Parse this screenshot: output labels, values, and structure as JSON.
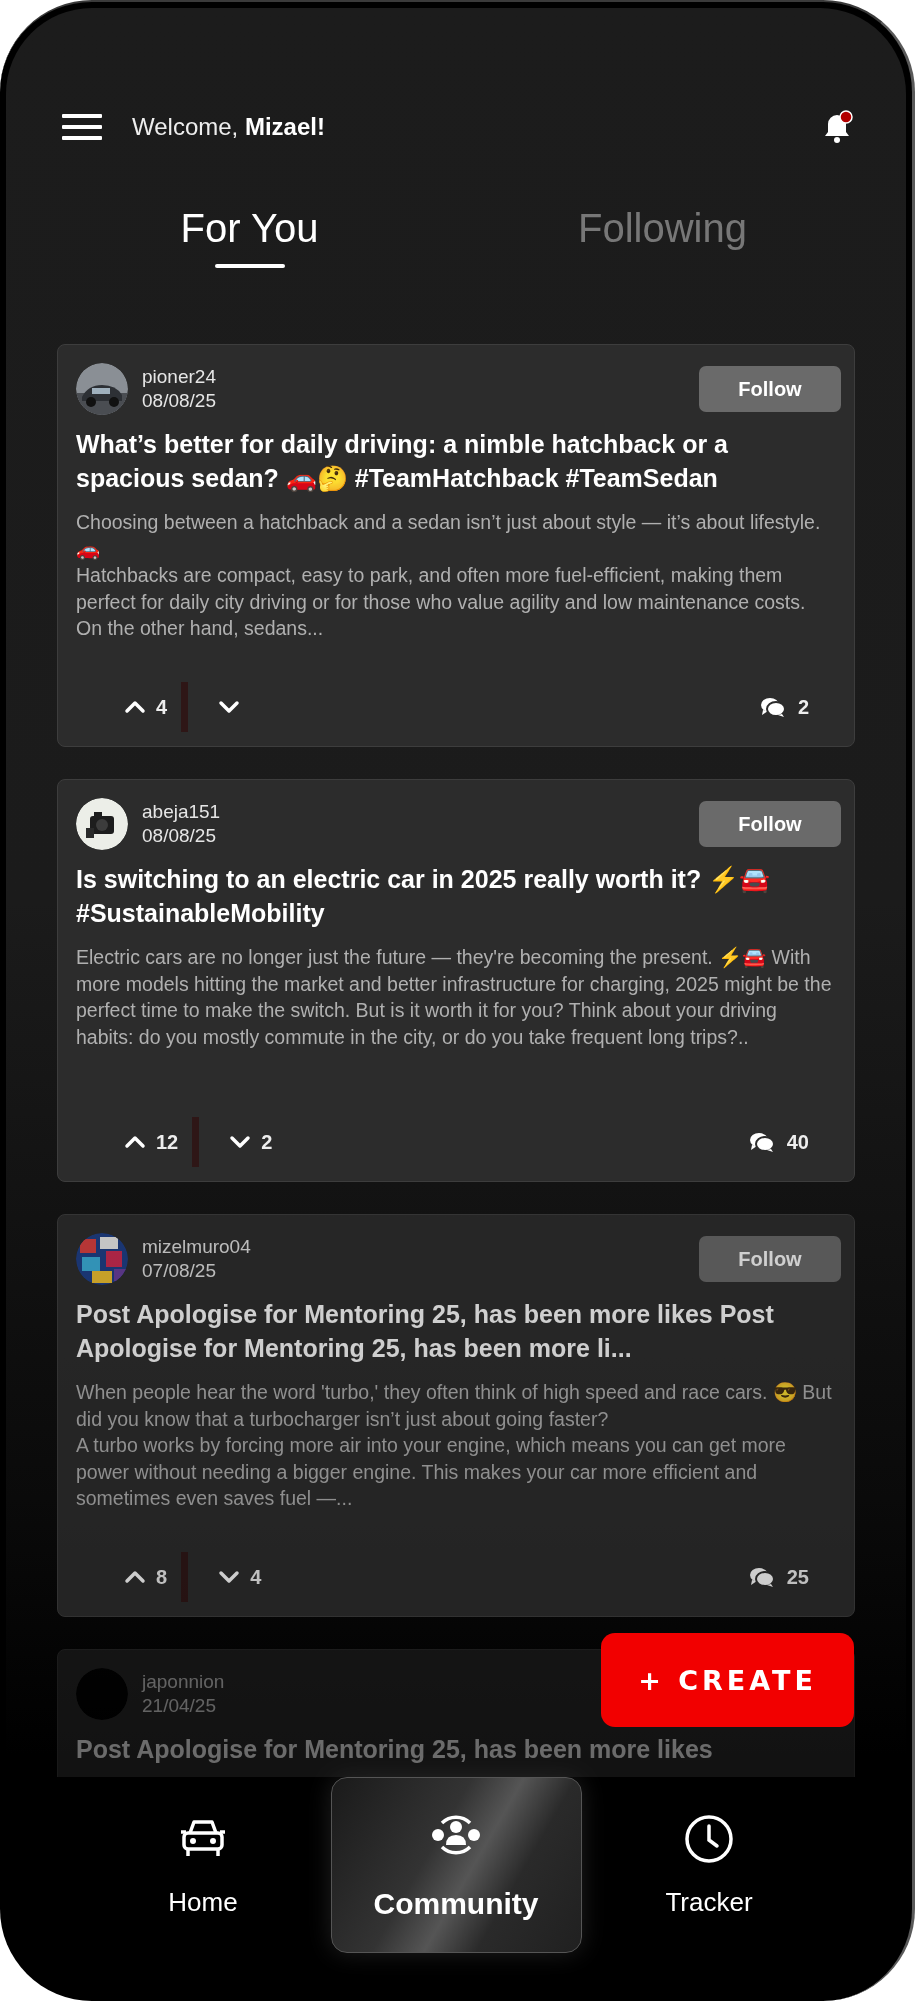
{
  "header": {
    "greeting": "Welcome, **Mizael!**",
    "has_notification": true
  },
  "tabs": [
    {
      "label": "For You",
      "selected": true
    },
    {
      "label": "Following",
      "selected": false
    }
  ],
  "posts": [
    {
      "author": "pioner24",
      "date": "08/08/25",
      "follow_label": "Follow",
      "title": "What’s better for daily driving: a nimble hatchback or a spacious sedan? 🚗🤔 #TeamHatchback #TeamSedan",
      "body": "Choosing between a hatchback and a sedan isn’t just about style — it’s about lifestyle. 🚗\n Hatchbacks are compact, easy to park, and often more fuel-efficient, making them perfect for daily city driving or for those who value agility and low maintenance costs. On the other hand, sedans...",
      "upvotes": "4",
      "comments": "2"
    },
    {
      "author": "abeja151",
      "date": "08/08/25",
      "follow_label": "Follow",
      "title": "Is switching to an electric car in 2025 really worth it? ⚡🚘 #SustainableMobility",
      "body": "Electric cars are no longer just the future — they're becoming the present. ⚡🚘 With more models hitting the market and better infrastructure for charging, 2025 might be the perfect time to make the switch. But is it worth it for you? Think about your driving habits: do you mostly commute in the city, or do you take frequent long trips?..",
      "upvotes": "12",
      "downvotes": "2",
      "comments": "40"
    },
    {
      "author": "mizelmuro04",
      "date": "07/08/25",
      "follow_label": "Follow",
      "title": "Post Apologise for Mentoring 25, has been more likes Post Apologise for Mentoring 25, has been more li...",
      "body": "When people hear the word 'turbo,' they often think of high speed and race cars. 😎 But did you know that a turbocharger isn’t just about going faster?\n A turbo works by forcing more air into your engine, which means you can get more power without needing a bigger engine. This makes your car more efficient and sometimes even saves fuel —...",
      "upvotes": "8",
      "downvotes": "4",
      "comments": "25"
    },
    {
      "author": "japonnion",
      "date": "21/04/25",
      "avatar": {
        "kind": "blank"
      },
      "title": "Post Apologise for Mentoring 25, has been more likes"
    }
  ],
  "create_button": "+ CREATE",
  "nav": [
    {
      "label": "Home",
      "kind": "car",
      "selected": false
    },
    {
      "label": "Community",
      "kind": "community",
      "selected": true
    },
    {
      "label": "Tracker",
      "kind": "clock",
      "selected": false
    }
  ]
}
